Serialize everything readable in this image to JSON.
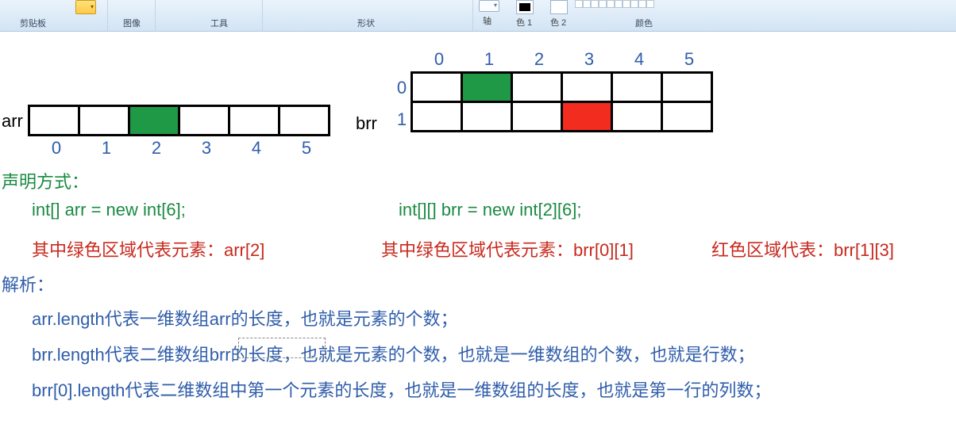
{
  "ribbon": {
    "groups": {
      "clipboard": "剪贴板",
      "image": "图像",
      "tools": "工具",
      "shapes": "形状",
      "colors": "颜色"
    },
    "axis_label": "轴",
    "color1_label": "色 1",
    "color2_label": "色 2"
  },
  "arr": {
    "label": "arr",
    "indices": [
      "0",
      "1",
      "2",
      "3",
      "4",
      "5"
    ],
    "green_cell": 2,
    "declaration": "int[] arr = new int[6];",
    "green_desc": "其中绿色区域代表元素：arr[2]"
  },
  "brr": {
    "label": "brr",
    "col_indices": [
      "0",
      "1",
      "2",
      "3",
      "4",
      "5"
    ],
    "row_indices": [
      "0",
      "1"
    ],
    "green_cell": {
      "r": 0,
      "c": 1
    },
    "red_cell": {
      "r": 1,
      "c": 3
    },
    "declaration": "int[][] brr = new int[2][6];",
    "green_desc": "其中绿色区域代表元素：brr[0][1]",
    "red_desc": "红色区域代表：brr[1][3]"
  },
  "section_decl_title": "声明方式：",
  "section_parse_title": "解析：",
  "parse_lines": [
    "arr.length代表一维数组arr的长度，也就是元素的个数；",
    "brr.length代表二维数组brr的长度，也就是元素的个数，也就是一维数组的个数，也就是行数；",
    "brr[0].length代表二维数组中第一个元素的长度，也就是一维数组的长度，也就是第一行的列数；"
  ],
  "chart_data": [
    {
      "type": "table",
      "name": "arr",
      "rows": 1,
      "cols": 6,
      "highlights": [
        {
          "row": 0,
          "col": 2,
          "color": "green"
        }
      ]
    },
    {
      "type": "table",
      "name": "brr",
      "rows": 2,
      "cols": 6,
      "highlights": [
        {
          "row": 0,
          "col": 1,
          "color": "green"
        },
        {
          "row": 1,
          "col": 3,
          "color": "red"
        }
      ]
    }
  ]
}
